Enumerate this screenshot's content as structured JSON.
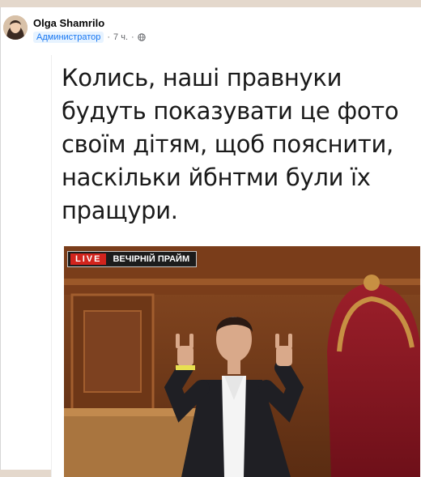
{
  "post": {
    "author": "Olga Shamrilo",
    "role": "Администратор",
    "time": "7 ч.",
    "separator": "·",
    "visibility_icon": "globe-icon"
  },
  "meme": {
    "caption": "Колись, наші правнуки будуть показувати це фото своїм дітям, щоб пояснити, наскільки йбнтми були їх пращури.",
    "live_label": "LIVE",
    "show_name": "ВЕЧІРНІЙ ПРАЙМ"
  },
  "colors": {
    "page_bg": "#e4d8cc",
    "badge_bg": "#e7f3ff",
    "badge_text": "#1877f2",
    "live_red": "#d2241d"
  }
}
